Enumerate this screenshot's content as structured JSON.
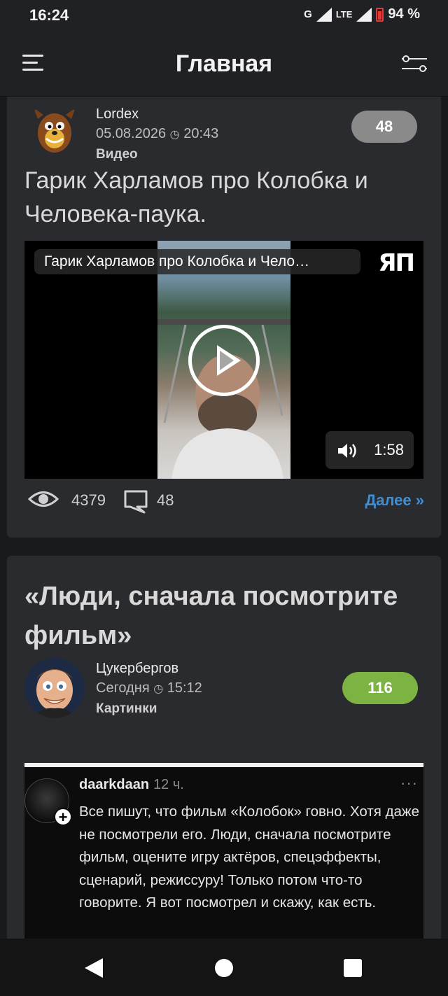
{
  "status_bar": {
    "time": "16:24",
    "network": "G",
    "lte": "LTE",
    "battery": "94 %"
  },
  "header": {
    "title": "Главная"
  },
  "posts": [
    {
      "author": "Lordex",
      "date": "05.08.2026",
      "time": "20:43",
      "category": "Видео",
      "rating": "48",
      "rating_color": "#8a8a8a",
      "title": "Гарик Харламов про Колобка и Человека-паука.",
      "video": {
        "title": "Гарик Харламов про Колобка и Чело…",
        "logo": "ЯП",
        "duration": "1:58"
      },
      "views": "4379",
      "comments": "48",
      "more_link": "Далее »"
    },
    {
      "title": "«Люди, сначала посмотрите фильм»",
      "author": "Цукербергов",
      "date": "Сегодня",
      "time": "15:12",
      "category": "Картинки",
      "rating": "116",
      "rating_color": "#7cb342",
      "embedded_comment": {
        "user": "daarkdaan",
        "time": "12 ч.",
        "menu": "···",
        "text": "Все пишут, что фильм «Колобок» говно. Хотя даже не посмотрели его. Люди, сначала посмотрите фильм, оцените игру актёров, спецэффекты, сценарий, режиссуру! Только потом что-то говорите. Я вот посмотрел и скажу, как есть."
      }
    }
  ]
}
